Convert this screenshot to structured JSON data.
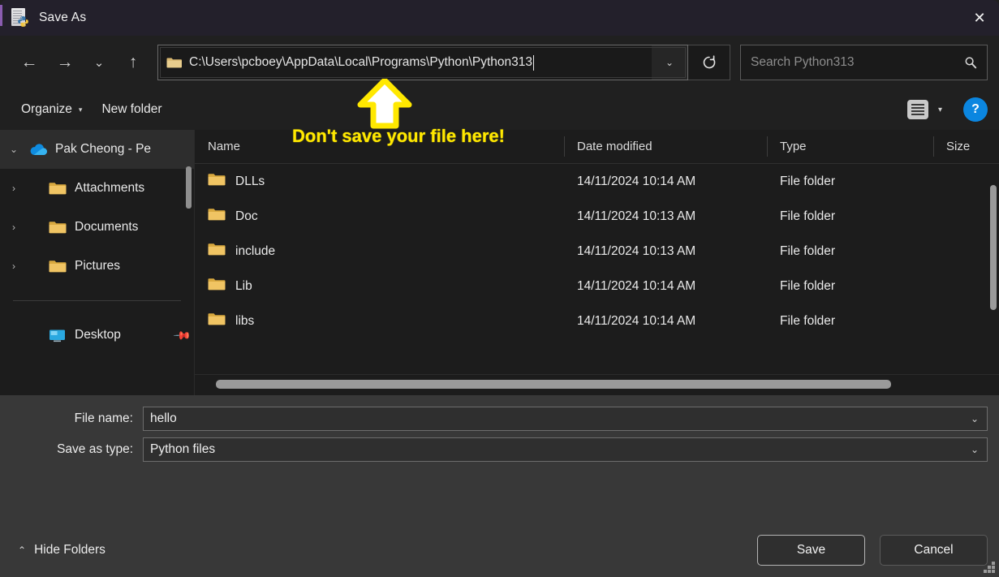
{
  "window": {
    "title": "Save As",
    "title_icon": "python-file-icon",
    "close_label": "✕"
  },
  "nav": {
    "back_icon": "←",
    "forward_icon": "→",
    "recent_icon": "⌄",
    "up_icon": "↑",
    "address_value": "C:\\Users\\pcboey\\AppData\\Local\\Programs\\Python\\Python313",
    "address_dropdown_icon": "⌄",
    "refresh_icon": "↻",
    "search_placeholder": "Search Python313",
    "search_value": "",
    "search_icon": "⌕"
  },
  "toolbar": {
    "organize_label": "Organize",
    "organize_caret": "▾",
    "new_folder_label": "New folder",
    "view_caret": "▾",
    "help_label": "?"
  },
  "annotation": {
    "text": "Don't save your file here!",
    "arrow_color": "#ffe800",
    "text_color": "#ffe800"
  },
  "sidebar": {
    "items": [
      {
        "label": "Pak Cheong - Pe",
        "icon": "onedrive-cloud-icon",
        "chevron": "⌄",
        "selected": true,
        "indent": 0,
        "pinned": false
      },
      {
        "label": "Attachments",
        "icon": "folder-icon",
        "chevron": "›",
        "selected": false,
        "indent": 1,
        "pinned": false
      },
      {
        "label": "Documents",
        "icon": "folder-icon",
        "chevron": "›",
        "selected": false,
        "indent": 1,
        "pinned": false
      },
      {
        "label": "Pictures",
        "icon": "folder-icon",
        "chevron": "›",
        "selected": false,
        "indent": 1,
        "pinned": false
      },
      {
        "label": "Desktop",
        "icon": "desktop-monitor-icon",
        "chevron": "",
        "selected": false,
        "indent": 1,
        "pinned": true
      }
    ]
  },
  "filelist": {
    "columns": [
      "Name",
      "Date modified",
      "Type",
      "Size"
    ],
    "rows": [
      {
        "name": "DLLs",
        "date": "14/11/2024 10:14 AM",
        "type": "File folder",
        "size": ""
      },
      {
        "name": "Doc",
        "date": "14/11/2024 10:13 AM",
        "type": "File folder",
        "size": ""
      },
      {
        "name": "include",
        "date": "14/11/2024 10:13 AM",
        "type": "File folder",
        "size": ""
      },
      {
        "name": "Lib",
        "date": "14/11/2024 10:14 AM",
        "type": "File folder",
        "size": ""
      },
      {
        "name": "libs",
        "date": "14/11/2024 10:14 AM",
        "type": "File folder",
        "size": ""
      }
    ]
  },
  "form": {
    "file_name_label": "File name:",
    "file_name_value": "hello",
    "save_as_type_label": "Save as type:",
    "save_as_type_value": "Python files",
    "chevron": "⌄"
  },
  "footer": {
    "hide_folders_label": "Hide Folders",
    "hide_folders_caret": "⌃",
    "save_label": "Save",
    "cancel_label": "Cancel"
  }
}
